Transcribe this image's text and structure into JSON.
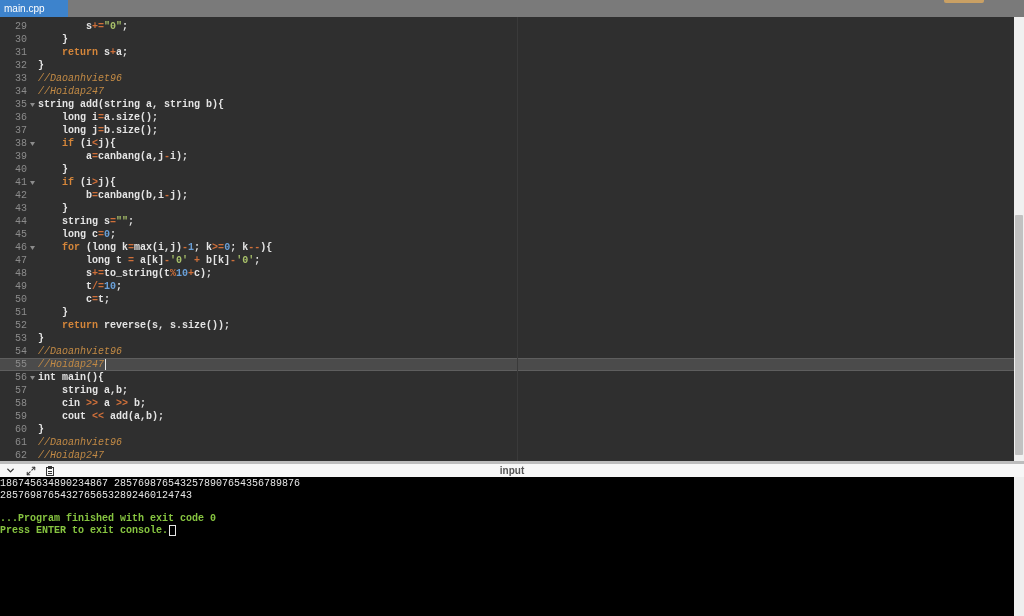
{
  "tabs": [
    {
      "label": "main.cpp",
      "selected": true
    }
  ],
  "editor": {
    "lines": [
      {
        "number": "29",
        "foldable": false,
        "active": false,
        "tokens": [
          {
            "kind": "plain",
            "text": "        s"
          },
          {
            "kind": "operator",
            "text": "+="
          },
          {
            "kind": "string",
            "text": "\"0\""
          },
          {
            "kind": "plain",
            "text": ";"
          }
        ]
      },
      {
        "number": "30",
        "foldable": false,
        "active": false,
        "tokens": [
          {
            "kind": "plain",
            "text": "    }"
          }
        ]
      },
      {
        "number": "31",
        "foldable": false,
        "active": false,
        "tokens": [
          {
            "kind": "keyword",
            "text": "    return"
          },
          {
            "kind": "plain",
            "text": " s"
          },
          {
            "kind": "operator",
            "text": "+"
          },
          {
            "kind": "plain",
            "text": "a;"
          }
        ]
      },
      {
        "number": "32",
        "foldable": false,
        "active": false,
        "tokens": [
          {
            "kind": "plain",
            "text": "}"
          }
        ]
      },
      {
        "number": "33",
        "foldable": false,
        "active": false,
        "tokens": [
          {
            "kind": "comment",
            "text": "//Daoanhviet96"
          }
        ]
      },
      {
        "number": "34",
        "foldable": false,
        "active": false,
        "tokens": [
          {
            "kind": "comment",
            "text": "//Hoidap247"
          }
        ]
      },
      {
        "number": "35",
        "foldable": true,
        "active": false,
        "tokens": [
          {
            "kind": "plain",
            "text": "string add(string a, string b){"
          }
        ]
      },
      {
        "number": "36",
        "foldable": false,
        "active": false,
        "tokens": [
          {
            "kind": "plain",
            "text": "    long i"
          },
          {
            "kind": "operator",
            "text": "="
          },
          {
            "kind": "plain",
            "text": "a.size();"
          }
        ]
      },
      {
        "number": "37",
        "foldable": false,
        "active": false,
        "tokens": [
          {
            "kind": "plain",
            "text": "    long j"
          },
          {
            "kind": "operator",
            "text": "="
          },
          {
            "kind": "plain",
            "text": "b.size();"
          }
        ]
      },
      {
        "number": "38",
        "foldable": true,
        "active": false,
        "tokens": [
          {
            "kind": "keyword",
            "text": "    if"
          },
          {
            "kind": "plain",
            "text": " (i"
          },
          {
            "kind": "operator",
            "text": "<"
          },
          {
            "kind": "plain",
            "text": "j){"
          }
        ]
      },
      {
        "number": "39",
        "foldable": false,
        "active": false,
        "tokens": [
          {
            "kind": "plain",
            "text": "        a"
          },
          {
            "kind": "operator",
            "text": "="
          },
          {
            "kind": "plain",
            "text": "canbang(a,j"
          },
          {
            "kind": "operator",
            "text": "-"
          },
          {
            "kind": "plain",
            "text": "i);"
          }
        ]
      },
      {
        "number": "40",
        "foldable": false,
        "active": false,
        "tokens": [
          {
            "kind": "plain",
            "text": "    }"
          }
        ]
      },
      {
        "number": "41",
        "foldable": true,
        "active": false,
        "tokens": [
          {
            "kind": "keyword",
            "text": "    if"
          },
          {
            "kind": "plain",
            "text": " (i"
          },
          {
            "kind": "operator",
            "text": ">"
          },
          {
            "kind": "plain",
            "text": "j){"
          }
        ]
      },
      {
        "number": "42",
        "foldable": false,
        "active": false,
        "tokens": [
          {
            "kind": "plain",
            "text": "        b"
          },
          {
            "kind": "operator",
            "text": "="
          },
          {
            "kind": "plain",
            "text": "canbang(b,i"
          },
          {
            "kind": "operator",
            "text": "-"
          },
          {
            "kind": "plain",
            "text": "j);"
          }
        ]
      },
      {
        "number": "43",
        "foldable": false,
        "active": false,
        "tokens": [
          {
            "kind": "plain",
            "text": "    }"
          }
        ]
      },
      {
        "number": "44",
        "foldable": false,
        "active": false,
        "tokens": [
          {
            "kind": "plain",
            "text": "    string s"
          },
          {
            "kind": "operator",
            "text": "="
          },
          {
            "kind": "string",
            "text": "\"\""
          },
          {
            "kind": "plain",
            "text": ";"
          }
        ]
      },
      {
        "number": "45",
        "foldable": false,
        "active": false,
        "tokens": [
          {
            "kind": "plain",
            "text": "    long c"
          },
          {
            "kind": "operator",
            "text": "="
          },
          {
            "kind": "number",
            "text": "0"
          },
          {
            "kind": "plain",
            "text": ";"
          }
        ]
      },
      {
        "number": "46",
        "foldable": true,
        "active": false,
        "tokens": [
          {
            "kind": "keyword",
            "text": "    for"
          },
          {
            "kind": "plain",
            "text": " (long k"
          },
          {
            "kind": "operator",
            "text": "="
          },
          {
            "kind": "plain",
            "text": "max(i,j)"
          },
          {
            "kind": "operator",
            "text": "-"
          },
          {
            "kind": "number",
            "text": "1"
          },
          {
            "kind": "plain",
            "text": "; k"
          },
          {
            "kind": "operator",
            "text": ">="
          },
          {
            "kind": "number",
            "text": "0"
          },
          {
            "kind": "plain",
            "text": "; k"
          },
          {
            "kind": "operator",
            "text": "--"
          },
          {
            "kind": "plain",
            "text": "){"
          }
        ]
      },
      {
        "number": "47",
        "foldable": false,
        "active": false,
        "tokens": [
          {
            "kind": "plain",
            "text": "        long t "
          },
          {
            "kind": "operator",
            "text": "="
          },
          {
            "kind": "plain",
            "text": " a[k]"
          },
          {
            "kind": "operator",
            "text": "-"
          },
          {
            "kind": "string",
            "text": "'0'"
          },
          {
            "kind": "operator",
            "text": " +"
          },
          {
            "kind": "plain",
            "text": " b[k]"
          },
          {
            "kind": "operator",
            "text": "-"
          },
          {
            "kind": "string",
            "text": "'0'"
          },
          {
            "kind": "plain",
            "text": ";"
          }
        ]
      },
      {
        "number": "48",
        "foldable": false,
        "active": false,
        "tokens": [
          {
            "kind": "plain",
            "text": "        s"
          },
          {
            "kind": "operator",
            "text": "+="
          },
          {
            "kind": "plain",
            "text": "to_string(t"
          },
          {
            "kind": "operator",
            "text": "%"
          },
          {
            "kind": "number",
            "text": "10"
          },
          {
            "kind": "operator",
            "text": "+"
          },
          {
            "kind": "plain",
            "text": "c);"
          }
        ]
      },
      {
        "number": "49",
        "foldable": false,
        "active": false,
        "tokens": [
          {
            "kind": "plain",
            "text": "        t"
          },
          {
            "kind": "operator",
            "text": "/="
          },
          {
            "kind": "number",
            "text": "10"
          },
          {
            "kind": "plain",
            "text": ";"
          }
        ]
      },
      {
        "number": "50",
        "foldable": false,
        "active": false,
        "tokens": [
          {
            "kind": "plain",
            "text": "        c"
          },
          {
            "kind": "operator",
            "text": "="
          },
          {
            "kind": "plain",
            "text": "t;"
          }
        ]
      },
      {
        "number": "51",
        "foldable": false,
        "active": false,
        "tokens": [
          {
            "kind": "plain",
            "text": "    }"
          }
        ]
      },
      {
        "number": "52",
        "foldable": false,
        "active": false,
        "tokens": [
          {
            "kind": "keyword",
            "text": "    return"
          },
          {
            "kind": "plain",
            "text": " reverse(s, s.size());"
          }
        ]
      },
      {
        "number": "53",
        "foldable": false,
        "active": false,
        "tokens": [
          {
            "kind": "plain",
            "text": "}"
          }
        ]
      },
      {
        "number": "54",
        "foldable": false,
        "active": false,
        "tokens": [
          {
            "kind": "comment",
            "text": "//Daoanhviet96"
          }
        ]
      },
      {
        "number": "55",
        "foldable": false,
        "active": true,
        "tokens": [
          {
            "kind": "comment",
            "text": "//Hoidap247"
          }
        ]
      },
      {
        "number": "56",
        "foldable": true,
        "active": false,
        "tokens": [
          {
            "kind": "plain",
            "text": "int main(){"
          }
        ]
      },
      {
        "number": "57",
        "foldable": false,
        "active": false,
        "tokens": [
          {
            "kind": "plain",
            "text": "    string a,b;"
          }
        ]
      },
      {
        "number": "58",
        "foldable": false,
        "active": false,
        "tokens": [
          {
            "kind": "plain",
            "text": "    cin "
          },
          {
            "kind": "operator",
            "text": ">>"
          },
          {
            "kind": "plain",
            "text": " a "
          },
          {
            "kind": "operator",
            "text": ">>"
          },
          {
            "kind": "plain",
            "text": " b;"
          }
        ]
      },
      {
        "number": "59",
        "foldable": false,
        "active": false,
        "tokens": [
          {
            "kind": "plain",
            "text": "    cout "
          },
          {
            "kind": "operator",
            "text": "<<"
          },
          {
            "kind": "plain",
            "text": " add(a,b);"
          }
        ]
      },
      {
        "number": "60",
        "foldable": false,
        "active": false,
        "tokens": [
          {
            "kind": "plain",
            "text": "}"
          }
        ]
      },
      {
        "number": "61",
        "foldable": false,
        "active": false,
        "tokens": [
          {
            "kind": "comment",
            "text": "//Daoanhviet96"
          }
        ]
      },
      {
        "number": "62",
        "foldable": false,
        "active": false,
        "tokens": [
          {
            "kind": "comment",
            "text": "//Hoidap247"
          }
        ]
      }
    ]
  },
  "toolbar": {
    "tab": "input"
  },
  "console": {
    "output_lines": [
      "186745634890234867 2857698765432578907654356789876",
      "28576987654327656532892460124743"
    ],
    "status_lines": [
      {
        "text": "...Program finished with exit code 0",
        "cursor": false
      },
      {
        "text": "Press ENTER to exit console.",
        "cursor": true
      }
    ]
  }
}
